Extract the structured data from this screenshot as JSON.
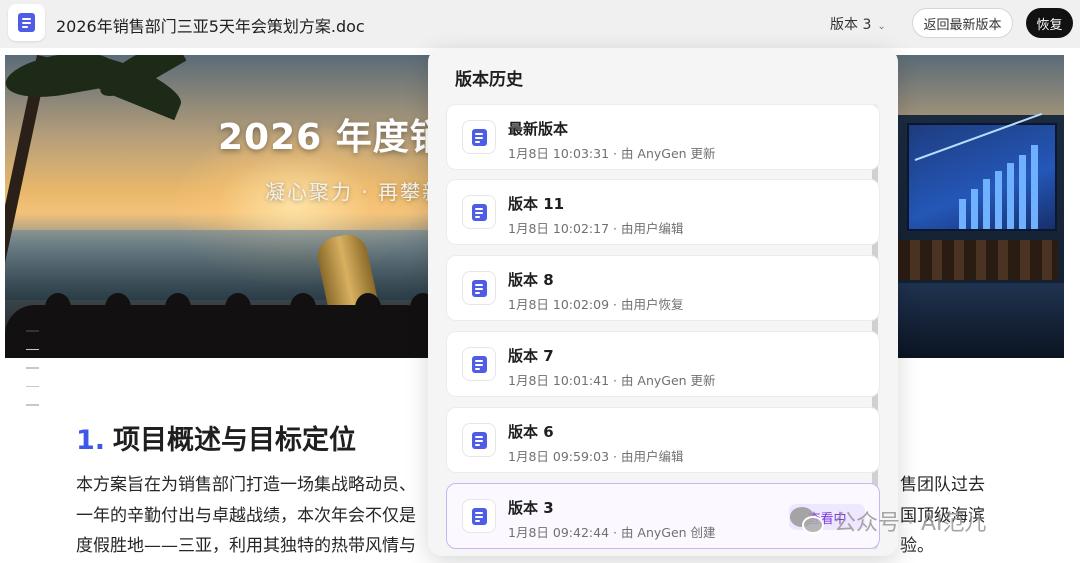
{
  "header": {
    "doc_title": "2026年销售部门三亚5天年会策划方案.doc",
    "version_label": "版本 3",
    "return_latest_label": "返回最新版本",
    "restore_label": "恢复"
  },
  "hero": {
    "title": "2026 年度销",
    "subtitle": "凝心聚力 · 再攀新"
  },
  "document": {
    "section_number": "1.",
    "section_title": "项目概述与目标定位",
    "lines_left": [
      "本方案旨在为销售部门打造一场集战略动员、",
      "一年的辛勤付出与卓越战绩，本次年会不仅是",
      "度假胜地——三亚，利用其独特的热带风情与"
    ],
    "lines_right": [
      "售团队过去",
      "国顶级海滨",
      "验。"
    ]
  },
  "version_panel": {
    "title": "版本历史",
    "items": [
      {
        "name": "最新版本",
        "meta": "1月8日 10:03:31 · 由 AnyGen 更新",
        "current": false
      },
      {
        "name": "版本 11",
        "meta": "1月8日 10:02:17 · 由用户编辑",
        "current": false
      },
      {
        "name": "版本 8",
        "meta": "1月8日 10:02:09 · 由用户恢复",
        "current": false
      },
      {
        "name": "版本 7",
        "meta": "1月8日 10:01:41 · 由 AnyGen 更新",
        "current": false
      },
      {
        "name": "版本 6",
        "meta": "1月8日 09:59:03 · 由用户编辑",
        "current": false
      },
      {
        "name": "版本 3",
        "meta": "1月8日 09:42:44 · 由 AnyGen 创建",
        "current": true,
        "badge": "查看中"
      }
    ]
  },
  "watermark": {
    "text": "公众号 · AI范儿"
  },
  "colors": {
    "accent": "#3f57e8",
    "doc_icon": "#4e5ce6",
    "viewing_badge_text": "#7a3ce0",
    "viewing_badge_bg": "#efe6ff",
    "restore_button": "#111111"
  },
  "icons": [
    "document-icon",
    "chevron-down-icon",
    "wechat-icon"
  ]
}
